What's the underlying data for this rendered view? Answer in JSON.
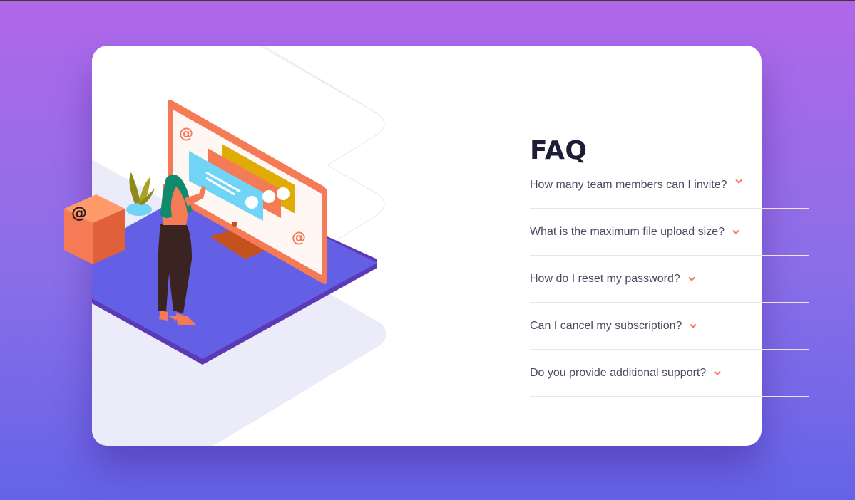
{
  "faq": {
    "title": "FAQ",
    "questions": [
      "How many team members can I invite?",
      "What is the maximum file upload size?",
      "How do I reset my password?",
      "Can I cancel my subscription?",
      "Do you provide additional support?"
    ]
  },
  "colors": {
    "background_top": "#b068e9",
    "background_bottom": "#6463e7",
    "title": "#1d1e35",
    "question_text": "#4a4b5e",
    "chevron": "#f47b56",
    "divider": "#e7e7e9"
  },
  "icons": [
    "at-sign-icon",
    "chevron-down-icon"
  ]
}
